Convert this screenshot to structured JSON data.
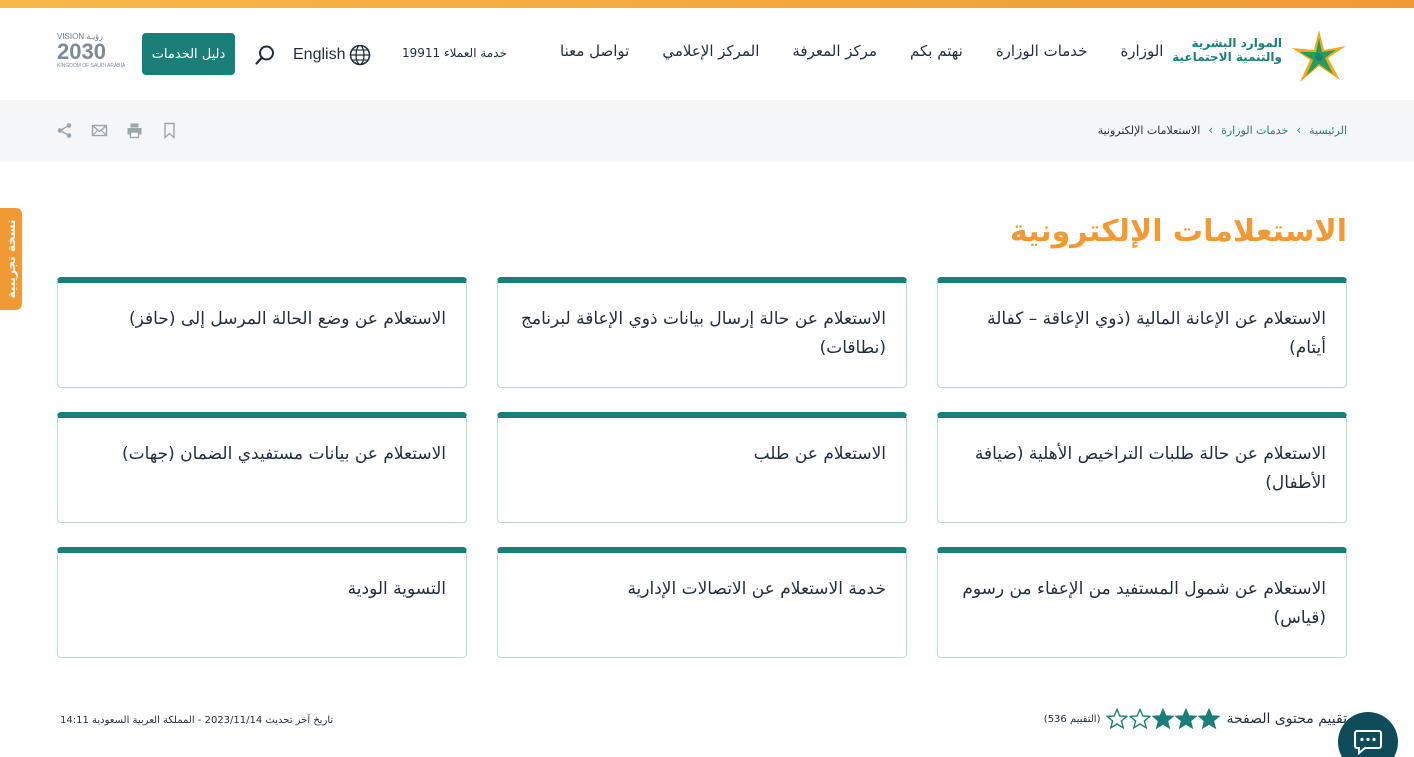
{
  "header": {
    "logo_line1": "الموارد البشرية",
    "logo_line2": "والتنمية الاجتماعية",
    "nav": [
      "الوزارة",
      "خدمات الوزارة",
      "نهتم بكم",
      "مركز المعرفة",
      "المركز الإعلامي",
      "تواصل معنا"
    ],
    "hotline": "خدمة العملاء 19911",
    "language": "English",
    "services_guide": "دليل الخدمات",
    "vision_top": "VISION رؤيـة",
    "vision_year": "2030",
    "vision_sub": "KINGDOM OF SAUDI ARABIA"
  },
  "breadcrumb": [
    "الرئيسية",
    "خدمات الوزارة",
    "الاستعلامات الإلكترونية"
  ],
  "beta_label": "نسخة تجريبية",
  "page_title": "الاستعلامات الإلكترونية",
  "cards": [
    "الاستعلام عن الإعانة المالية (ذوي الإعاقة – كفالة أيتام)",
    "الاستعلام عن حالة إرسال بيانات ذوي الإعاقة لبرنامج (نطاقات)",
    "الاستعلام عن وضع الحالة المرسل إلى (حافز)",
    "الاستعلام عن حالة طلبات التراخيص الأهلية (ضيافة الأطفال)",
    "الاستعلام عن طلب",
    "الاستعلام عن بيانات مستفيدي الضمان (جهات)",
    "الاستعلام عن شمول المستفيد من الإعفاء من رسوم (قياس)",
    "خدمة الاستعلام عن الاتصالات الإدارية",
    "التسوية الودية"
  ],
  "footer": {
    "rating_label": "تقييم محتوى الصفحة",
    "rating_value": 3,
    "rating_max": 5,
    "rating_count": "(التقييم 536)",
    "last_update": "تاريخ آخر تحديث 2023/11/14 - المملكة العربية السعودية 14:11"
  },
  "colors": {
    "brand": "#1b7f79",
    "accent": "#f19a35"
  }
}
